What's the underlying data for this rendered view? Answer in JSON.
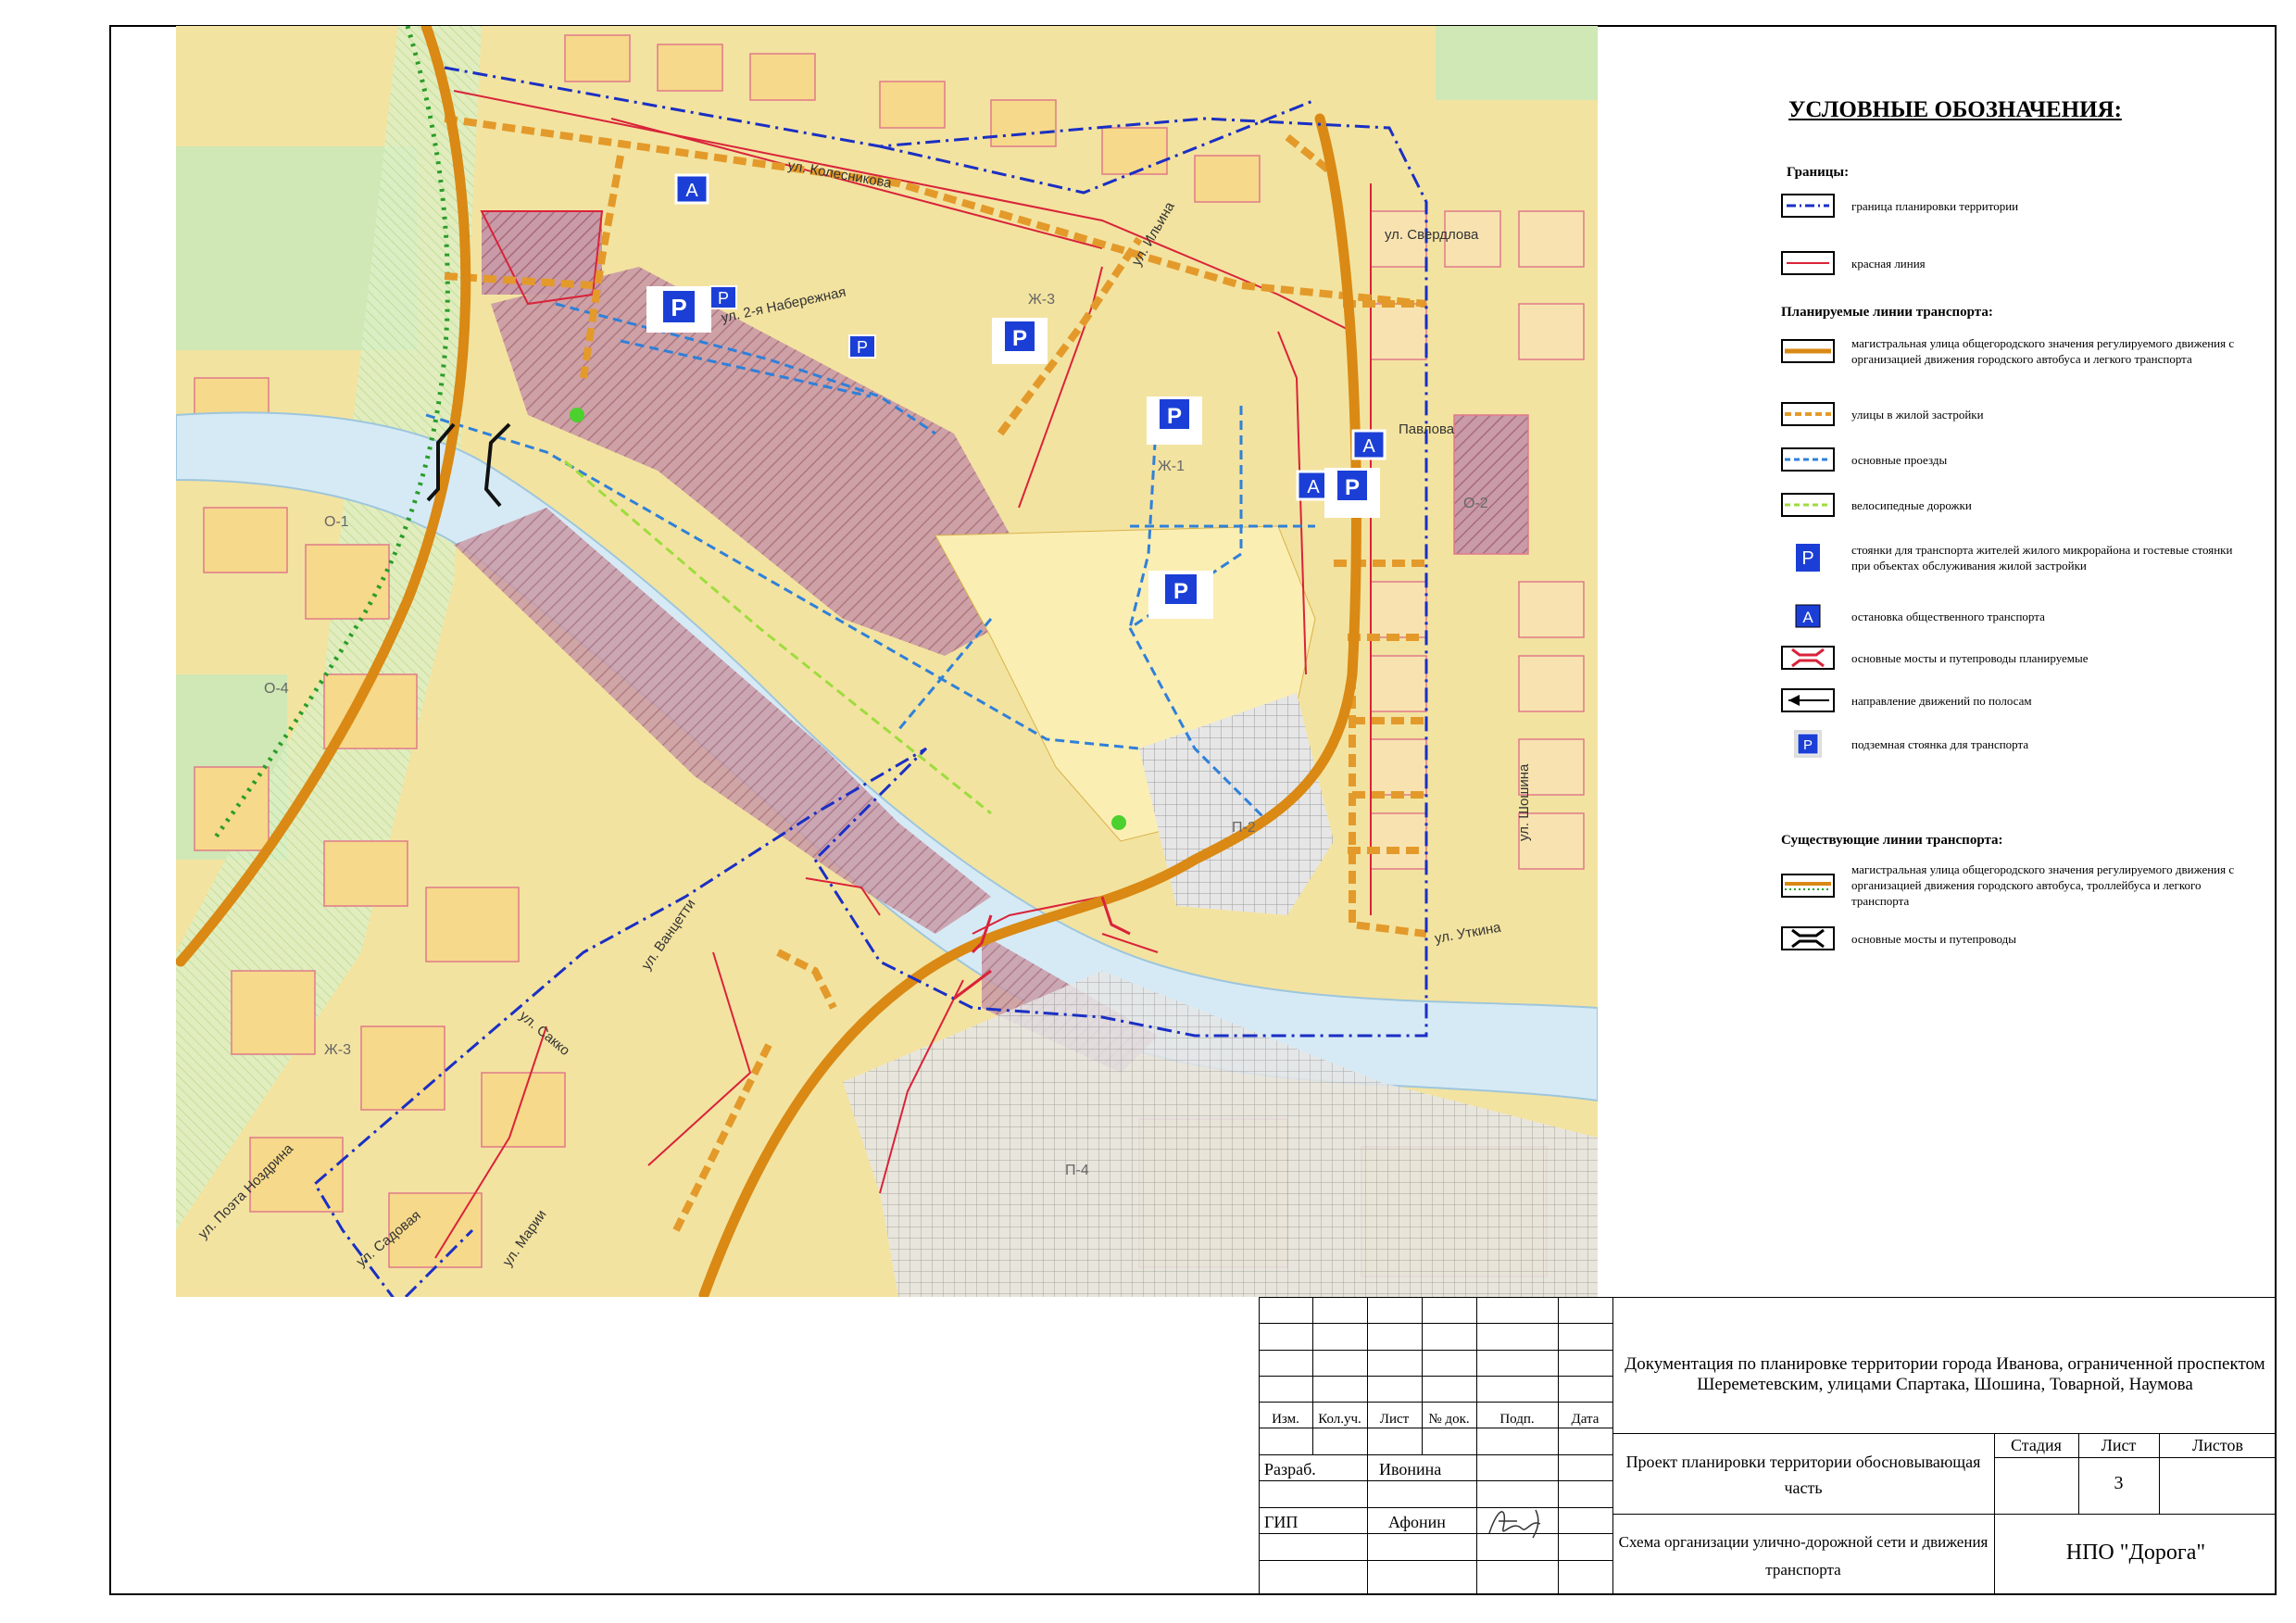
{
  "legend": {
    "title": "УСЛОВНЫЕ ОБОЗНАЧЕНИЯ:",
    "borders_header": "Границы:",
    "border_planning": "граница планировки территории",
    "red_line": "красная линия",
    "planned_header": "Планируемые линии транспорта:",
    "main_street_planned": "магистральная улица общегородского значения регулируемого движения с организацией движения городского автобуса и легкого транспорта",
    "residential_streets": "улицы в жилой застройки",
    "main_passages": "основные проезды",
    "bike_paths": "велосипедные дорожки",
    "parking": "стоянки для транспорта жителей жилого микрорайона и гостевые стоянки при объектах обслуживания жилой застройки",
    "bus_stop": "остановка общественного транспорта",
    "bridges_planned": "основные мосты и путепроводы планируемые",
    "lane_direction": "направление движений по полосам",
    "underground_parking": "подземная стоянка для транспорта",
    "existing_header": "Существующие линии транспорта:",
    "main_street_existing": "магистральная улица общегородского значения регулируемого движения с организацией движения городского автобуса, троллейбуса и легкого транспорта",
    "bridges_existing": "основные мосты и путепроводы"
  },
  "map_labels": {
    "kolesnikova": "ул. Колесникова",
    "naberezhnaya2": "ул. 2-я Набережная",
    "sverdlova": "ул. Свердлова",
    "pavlova": "Павлова",
    "ilyina": "ул. Ильина",
    "sakko": "ул. Сакко",
    "vantsetti": "ул. Ванцетти",
    "sadovaya": "ул. Садовая",
    "poeta_nozdrina": "ул. Поэта Ноздрина",
    "marii": "ул. Марии",
    "shoshina": "ул. Шошина",
    "utkina": "ул. Уткина",
    "zone_zh3": "Ж-3",
    "zone_zh1": "Ж-1",
    "zone_o1": "О-1",
    "zone_o2": "О-2",
    "zone_o4": "О-4",
    "zone_p2": "П-2",
    "zone_p4": "П-4",
    "stop_letter": "А",
    "parking_letter": "P"
  },
  "colors": {
    "map_bg": "#f3e6a0",
    "residential": "#f7dc8f",
    "green": "#cfe8b5",
    "river": "#d8ecf6",
    "hatched": "#b78a99",
    "orange_road": "#e39a2a",
    "blue_boundary": "#1a2fc4",
    "red_line": "#d9233a",
    "passage_blue": "#2f80d9",
    "bike_green": "#9edc3e",
    "sign_blue": "#1b3fd6"
  },
  "stamp": {
    "doc_title": "Документация по планировке территории города Иванова, ограниченной проспектом Шереметевским, улицами Спартака, Шошина, Товарной, Наумова",
    "col_izm": "Изм.",
    "col_kol": "Кол.уч.",
    "col_list": "Лист",
    "col_ndoc": "№ док.",
    "col_podp": "Подп.",
    "col_data": "Дата",
    "role_razrab": "Разраб.",
    "name_razrab": "Ивонина",
    "role_gip": "ГИП",
    "name_gip": "Афонин",
    "project_title": "Проект планировки территории обосновывающая часть",
    "stage_header": "Стадия",
    "sheet_header": "Лист",
    "sheets_header": "Листов",
    "sheet_number": "3",
    "scheme_title": "Схема организации улично-дорожной сети и движения транспорта",
    "org": "НПО \"Дорога\""
  }
}
